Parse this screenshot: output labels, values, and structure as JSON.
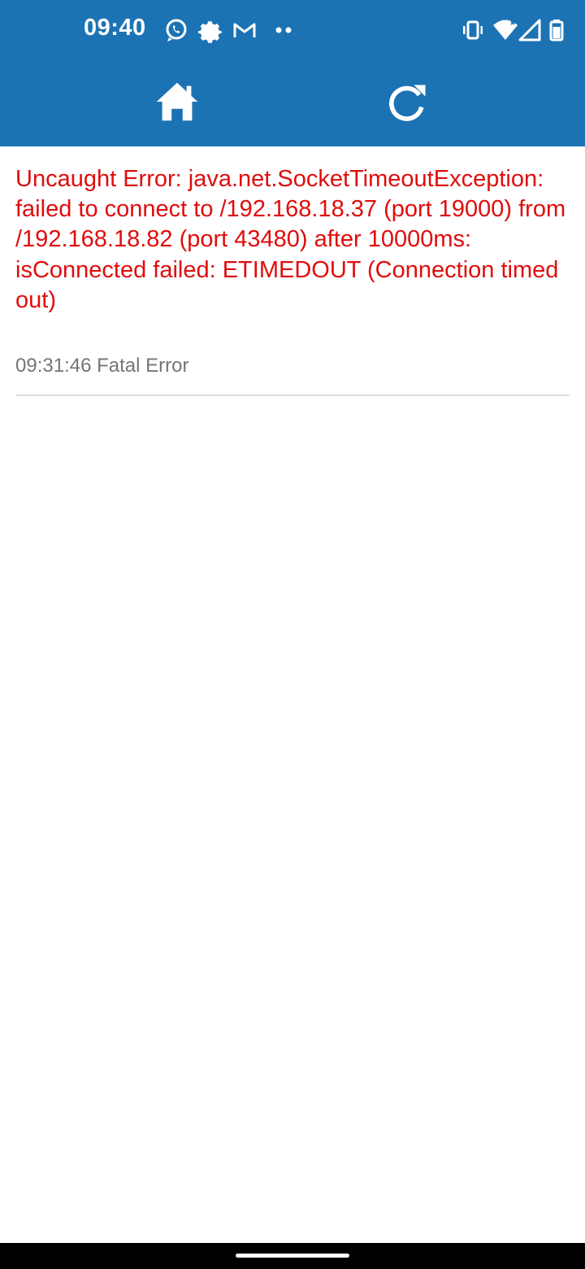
{
  "status_bar": {
    "time": "09:40",
    "notification_icons": [
      "whatsapp-icon",
      "settings-gear-icon",
      "gmail-icon",
      "more-dots-icon"
    ],
    "system_icons": [
      "vibrate-icon",
      "wifi-icon",
      "signal-icon",
      "battery-icon"
    ]
  },
  "toolbar": {
    "buttons": [
      {
        "name": "home",
        "icon": "home-icon"
      },
      {
        "name": "reload",
        "icon": "reload-icon"
      }
    ]
  },
  "error": {
    "message": "Uncaught Error: java.net.SocketTimeoutException: failed to connect to /192.168.18.37 (port 19000) from /192.168.18.82 (port 43480) after 10000ms: isConnected failed: ETIMEDOUT (Connection timed out)",
    "timestamp": "09:31:46",
    "level": "Fatal Error"
  },
  "colors": {
    "header": "#1c73b4",
    "error_text": "#e00d0d",
    "meta_text": "#757575",
    "divider": "#dddddd"
  }
}
